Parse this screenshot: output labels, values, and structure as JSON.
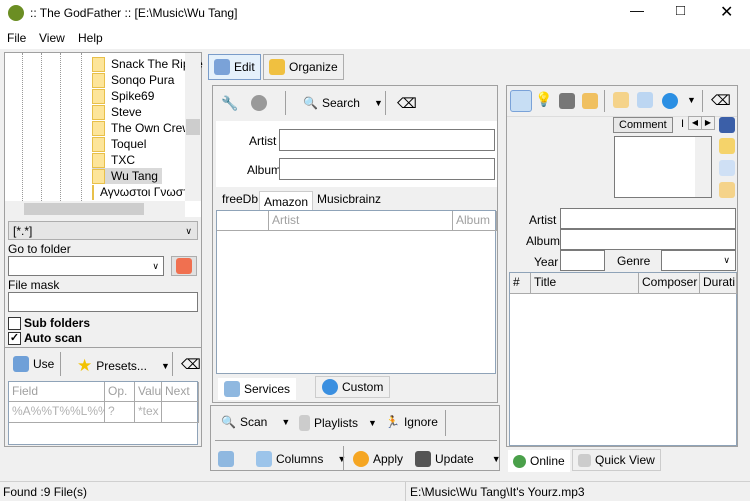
{
  "title": ":: The GodFather ::  [E:\\Music\\Wu Tang]",
  "menu": [
    "File",
    "View",
    "Help"
  ],
  "tree": {
    "items": [
      "Snack The Rippe",
      "Sonqo Pura",
      "Spike69",
      "Steve",
      "The Own Crew",
      "Toquel",
      "TXC",
      "Wu Tang",
      "Αγνωστοι Γνωστ"
    ],
    "selected": "Wu Tang"
  },
  "filter": {
    "value": "[*.*]"
  },
  "goto": {
    "label": "Go to folder",
    "value": ""
  },
  "mask": {
    "label": "File mask",
    "value": ""
  },
  "checks": [
    {
      "label": "Sub folders",
      "checked": false
    },
    {
      "label": "Auto scan",
      "checked": true
    }
  ],
  "lefttool": {
    "use": "Use",
    "presets": "Presets..."
  },
  "ruletable": {
    "headers": [
      "Field",
      "Op.",
      "Valu",
      "Next"
    ],
    "row": [
      "%A%%T%%L%%",
      "?",
      "*tex",
      ""
    ]
  },
  "center": {
    "tabs": [
      "Edit",
      "Organize"
    ],
    "search": "Search",
    "artist": "Artist",
    "album": "Album",
    "subtabs": [
      "freeDb",
      "Amazon",
      "Musicbrainz"
    ],
    "active_subtab": "Amazon",
    "cols": [
      "Artist",
      "Album"
    ],
    "bottomtabs": [
      "Services",
      "Custom"
    ]
  },
  "toolbar": {
    "scan": "Scan",
    "playlists": "Playlists",
    "ignore": "Ignore",
    "columns": "Columns",
    "apply": "Apply",
    "update": "Update"
  },
  "right": {
    "comment_tab": "Comment",
    "tab2": "I",
    "artist": "Artist",
    "album": "Album",
    "year": "Year",
    "genre": "Genre",
    "cols": [
      "#",
      "Title",
      "Composer",
      "Durati"
    ],
    "bottomtabs": [
      "Online",
      "Quick View"
    ]
  },
  "status": {
    "left": "Found :9 File(s)",
    "right": "E:\\Music\\Wu Tang\\It's Yourz.mp3"
  }
}
